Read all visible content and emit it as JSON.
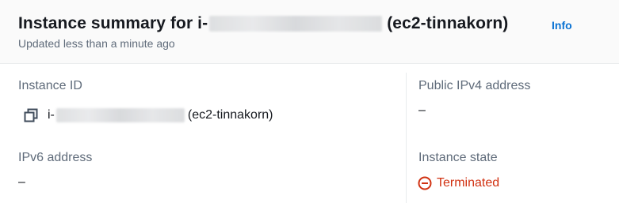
{
  "header": {
    "title_prefix": "Instance summary for i-",
    "title_suffix": "(ec2-tinnakorn)",
    "info_label": "Info",
    "updated_text": "Updated less than a minute ago"
  },
  "fields": {
    "instance_id": {
      "label": "Instance ID",
      "value_prefix": "i-",
      "value_suffix": "(ec2-tinnakorn)"
    },
    "public_ipv4": {
      "label": "Public IPv4 address",
      "value": "–"
    },
    "ipv6": {
      "label": "IPv6 address",
      "value": "–"
    },
    "instance_state": {
      "label": "Instance state",
      "value": "Terminated",
      "color": "#d13212"
    }
  },
  "icons": {
    "copy": "copy-icon",
    "state": "stopped-icon"
  },
  "colors": {
    "link": "#0972d3",
    "header_bg": "#fafafa",
    "label": "#5f6b7a",
    "text": "#16191f",
    "error": "#d13212"
  }
}
